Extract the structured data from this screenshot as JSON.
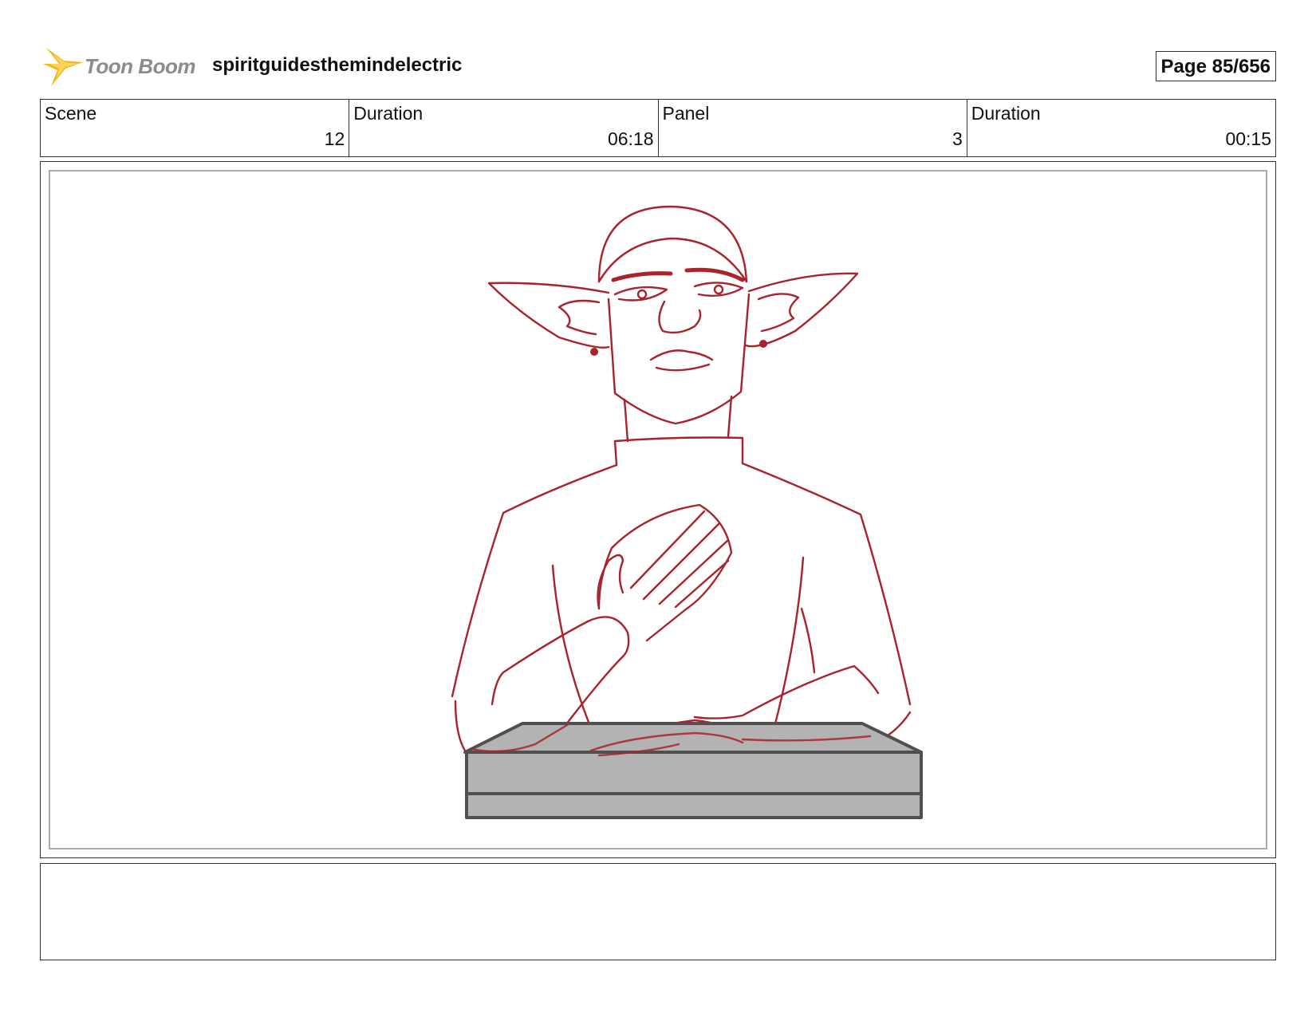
{
  "header": {
    "logo_text": "Toon Boom",
    "project_title": "spiritguidesthemindelectric",
    "page_label": "Page",
    "page_number": "85/656"
  },
  "info": {
    "scene_label": "Scene",
    "scene_value": "12",
    "scene_duration_label": "Duration",
    "scene_duration_value": "06:18",
    "panel_label": "Panel",
    "panel_value": "3",
    "panel_duration_label": "Duration",
    "panel_duration_value": "00:15"
  },
  "colors": {
    "sketch_line": "#a8232b",
    "desk_fill": "#b3b3b3",
    "desk_edge": "#505050",
    "logo_star": "#f3b51b"
  },
  "notes": {
    "text": ""
  }
}
